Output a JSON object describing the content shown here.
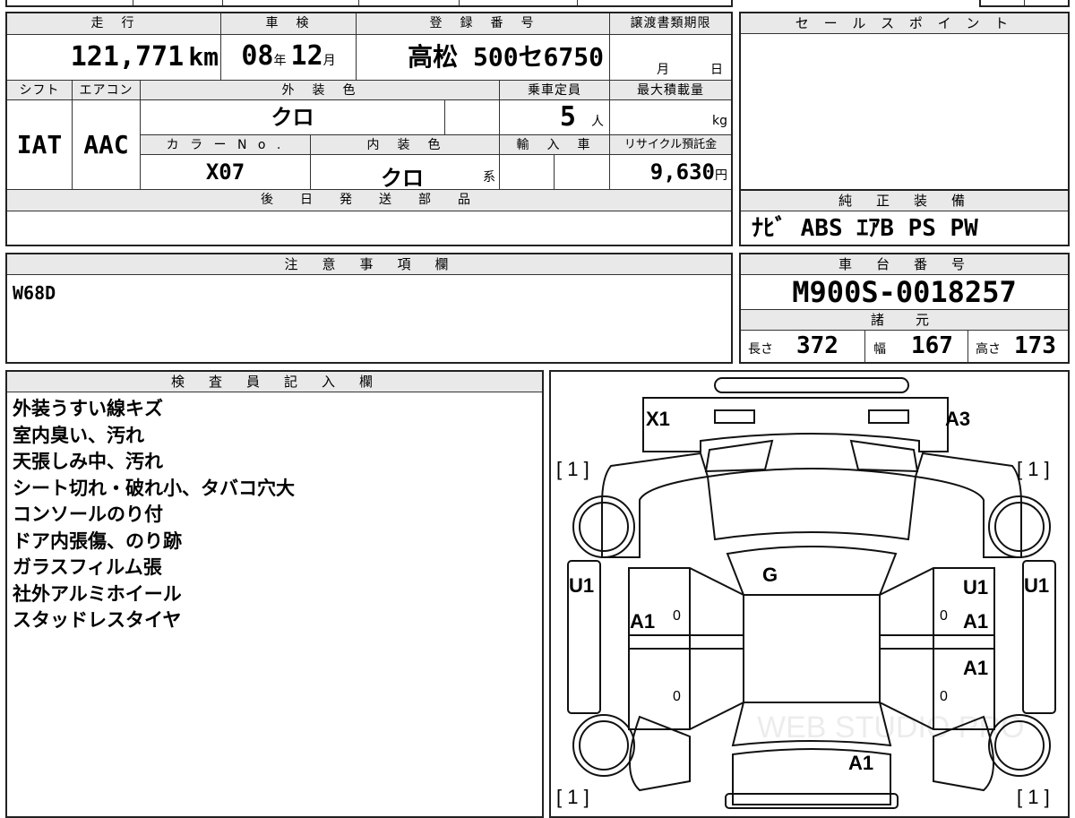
{
  "header": {
    "mileage_label": "走　行",
    "mileage_value": "121,771",
    "mileage_unit": "km",
    "shaken_label": "車　検",
    "shaken_year": "08",
    "shaken_year_unit": "年",
    "shaken_month": "12",
    "shaken_month_unit": "月",
    "plate_label": "登　録　番　号",
    "plate_value": "高松 500セ6750",
    "transfer_label": "譲渡書類期限",
    "transfer_month": "月",
    "transfer_day": "日",
    "shift_label": "シフト",
    "shift_value": "IAT",
    "aircon_label": "エアコン",
    "aircon_value": "AAC",
    "exterior_color_label": "外　装　色",
    "exterior_color_value": "クロ",
    "capacity_label": "乗車定員",
    "capacity_value": "5",
    "capacity_unit": "人",
    "max_load_label": "最大積載量",
    "max_load_unit": "kg",
    "color_no_label": "カ ラ ー N o .",
    "color_no_value": "X07",
    "interior_color_label": "内　装　色",
    "interior_color_value": "クロ",
    "interior_color_suffix": "系",
    "import_label": "輸　入　車",
    "recycle_label": "リサイクル預託金",
    "recycle_value": "9,630",
    "recycle_unit": "円",
    "later_parts_label": "後　日　発　送　部　品"
  },
  "sales_point": {
    "label": "セ ー ル ス ポ イ ン ト"
  },
  "equipment": {
    "label": "純　正　装　備",
    "value": "ﾅﾋﾞ ABS ｴｱB PS PW"
  },
  "caution": {
    "label": "注　意　事　項　欄",
    "value": "W68D"
  },
  "chassis": {
    "label": "車　台　番　号",
    "value": "M900S-0018257"
  },
  "specs": {
    "label": "諸　元",
    "length_label": "長さ",
    "length_value": "372",
    "width_label": "幅",
    "width_value": "167",
    "height_label": "高さ",
    "height_value": "173"
  },
  "inspector": {
    "label": "検　査　員　記　入　欄",
    "notes": [
      "外装うすい線キズ",
      "室内臭い、汚れ",
      "天張しみ中、汚れ",
      "シート切れ・破れ小、タバコ穴大",
      "コンソールのり付",
      "ドア内張傷、のり跡",
      "ガラスフィルム張",
      "社外アルミホイール",
      "スタッドレスタイヤ"
    ]
  },
  "diagram": {
    "front_left": "X1",
    "front_right": "A3",
    "windshield": "G",
    "left_pillar": "U1",
    "left_door": "A1",
    "right_pillar": "U1",
    "right_door_upper": "U1",
    "right_door_a1": "A1",
    "right_door_lower": "A1",
    "rear": "A1",
    "tire_tl": "[ 1 ]",
    "tire_tr": "[ 1 ]",
    "tire_bl": "[ 1 ]",
    "tire_br": "[ 1 ]",
    "zero": "0",
    "watermark": "WEB STUDIO PRO"
  }
}
